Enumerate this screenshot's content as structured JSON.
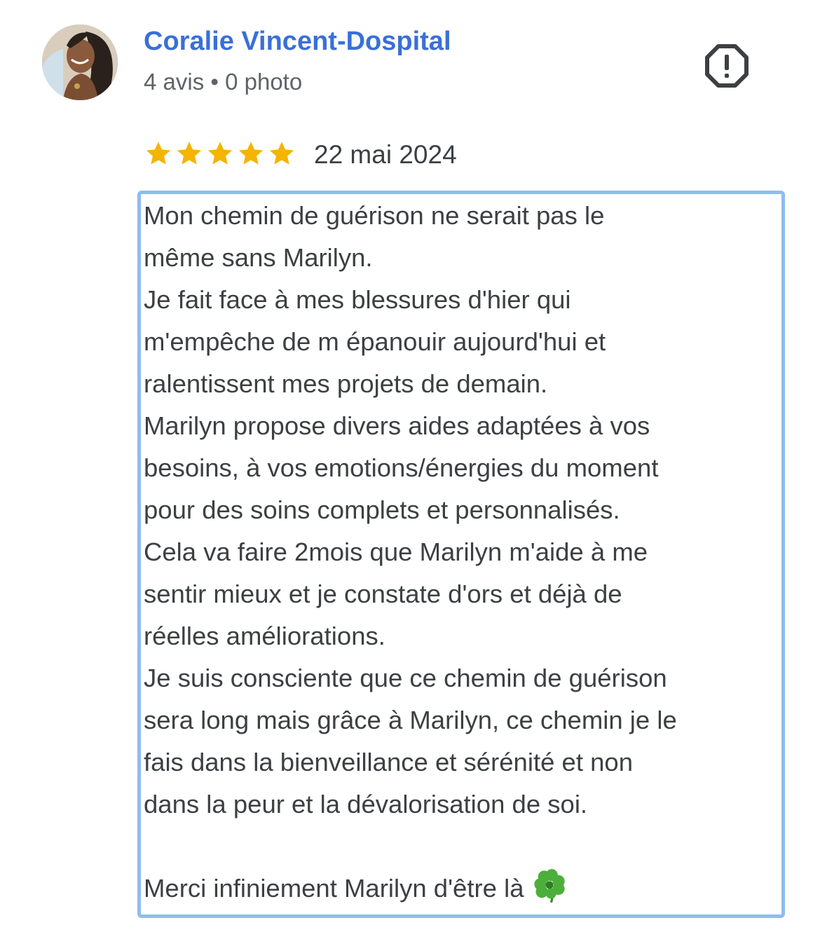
{
  "review": {
    "author": {
      "name": "Coralie Vincent-Dospital",
      "meta": "4 avis • 0 photo"
    },
    "rating": 5,
    "rating_max": 5,
    "date": "22 mai 2024",
    "text_lines": [
      "Mon chemin de guérison ne serait pas le",
      "même sans Marilyn.",
      "Je fait face à mes blessures d'hier qui",
      "m'empêche de m épanouir aujourd'hui et",
      "ralentissent mes projets de demain.",
      "Marilyn propose divers aides adaptées à vos",
      "besoins, à vos emotions/énergies du moment",
      "pour des soins complets et personnalisés.",
      "Cela va faire 2mois que Marilyn m'aide à me",
      "sentir mieux et je constate d'ors et déjà de",
      "réelles améliorations.",
      "Je suis consciente que ce chemin de guérison",
      "sera long mais grâce à Marilyn, ce chemin je le",
      "fais dans la bienveillance et sérénité et non",
      "dans la peur et la dévalorisation de soi.",
      "",
      "Merci infiniement Marilyn d'être là"
    ],
    "closing_emoji": "clover-icon"
  },
  "icons": {
    "report": "report-icon",
    "star": "star-icon"
  },
  "colors": {
    "author_name": "#3a6fd8",
    "star": "#f4b400",
    "selection_border": "#8fbcef",
    "text": "#3c4043",
    "meta": "#5f6368"
  }
}
